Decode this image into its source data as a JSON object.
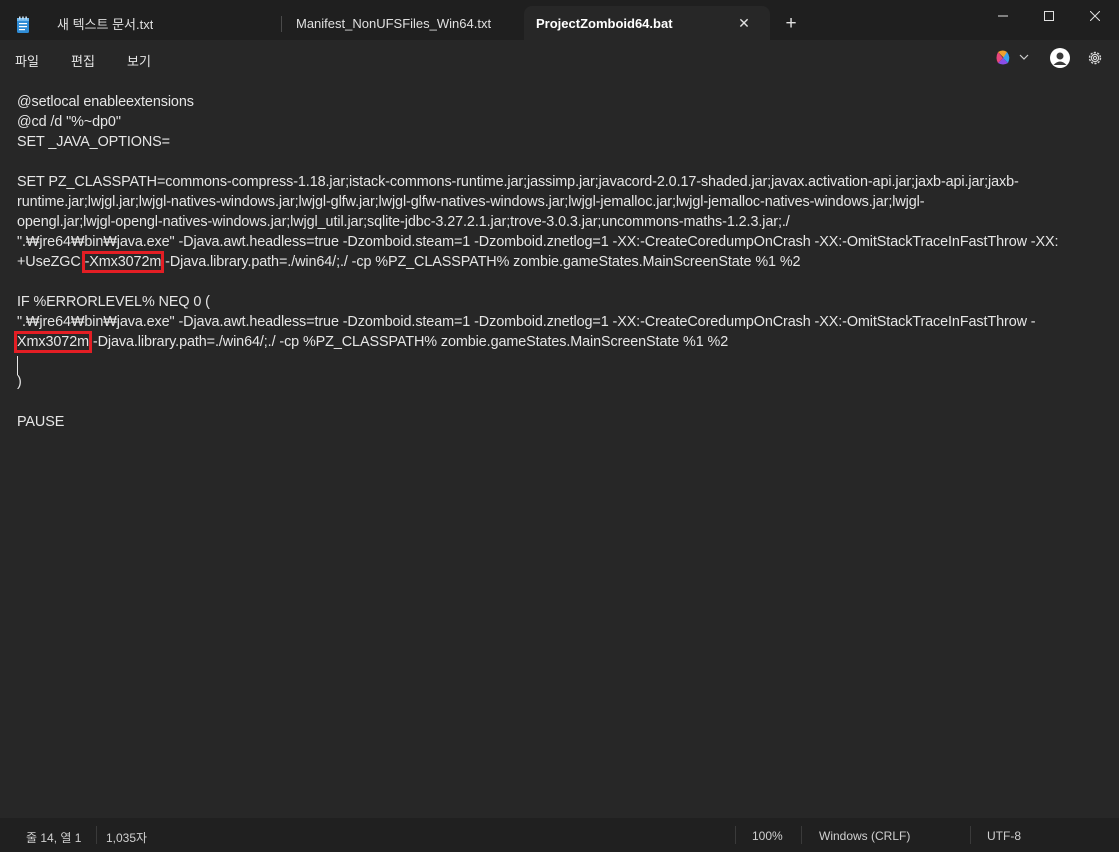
{
  "tabs": [
    {
      "label": "새 텍스트 문서.txt",
      "active": false
    },
    {
      "label": "Manifest_NonUFSFiles_Win64.txt",
      "active": false
    },
    {
      "label": "ProjectZomboid64.bat",
      "active": true
    }
  ],
  "tab_close_glyph": "✕",
  "new_tab_glyph": "+",
  "window_controls": {
    "minimize": "─",
    "maximize": "☐",
    "close": "✕"
  },
  "menu": {
    "file": "파일",
    "edit": "편집",
    "view": "보기"
  },
  "icons": {
    "app": "notepad-icon",
    "copilot": "copilot-icon",
    "account": "account-icon",
    "settings": "gear-icon"
  },
  "editor": {
    "lines": [
      "@setlocal enableextensions",
      "@cd /d \"%~dp0\"",
      "SET _JAVA_OPTIONS=",
      "",
      "SET PZ_CLASSPATH=commons-compress-1.18.jar;istack-commons-runtime.jar;jassimp.jar;javacord-2.0.17-shaded.jar;javax.activation-api.jar;jaxb-api.jar;jaxb-",
      "runtime.jar;lwjgl.jar;lwjgl-natives-windows.jar;lwjgl-glfw.jar;lwjgl-glfw-natives-windows.jar;lwjgl-jemalloc.jar;lwjgl-jemalloc-natives-windows.jar;lwjgl-",
      "opengl.jar;lwjgl-opengl-natives-windows.jar;lwjgl_util.jar;sqlite-jdbc-3.27.2.1.jar;trove-3.0.3.jar;uncommons-maths-1.2.3.jar;./",
      "\".₩jre64₩bin₩java.exe\" -Djava.awt.headless=true -Dzomboid.steam=1 -Dzomboid.znetlog=1 -XX:-CreateCoredumpOnCrash -XX:-OmitStackTraceInFastThrow -XX:",
      {
        "before": "+UseZGC ",
        "highlight": "-Xmx3072m",
        "after": " -Djava.library.path=./win64/;./ -cp %PZ_CLASSPATH% zombie.gameStates.MainScreenState %1 %2"
      },
      "",
      "IF %ERRORLEVEL% NEQ 0 (",
      "\".₩jre64₩bin₩java.exe\" -Djava.awt.headless=true -Dzomboid.steam=1 -Dzomboid.znetlog=1 -XX:-CreateCoredumpOnCrash -XX:-OmitStackTraceInFastThrow -",
      {
        "before": "",
        "highlight": "Xmx3072m",
        "after": " -Djava.library.path=./win64/;./ -cp %PZ_CLASSPATH% zombie.gameStates.MainScreenState %1 %2"
      },
      "",
      ")",
      "",
      "PAUSE"
    ]
  },
  "status": {
    "position": "줄 14, 열 1",
    "char_count": "1,035자",
    "zoom": "100%",
    "line_ending": "Windows (CRLF)",
    "encoding": "UTF-8"
  }
}
